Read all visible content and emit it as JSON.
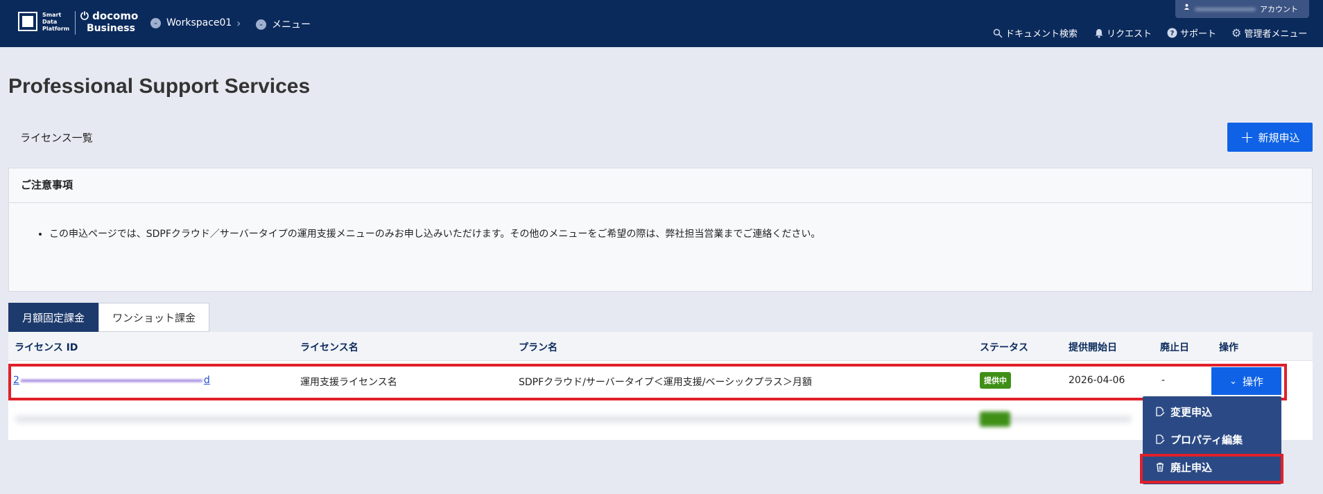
{
  "header": {
    "logo_lines": [
      "Smart",
      "Data",
      "Platform"
    ],
    "brand_top": "docomo",
    "brand_bottom": "Business",
    "breadcrumb": [
      "Workspace01",
      "メニュー"
    ],
    "account_label": "アカウント",
    "utilities": [
      "ドキュメント検索",
      "リクエスト",
      "サポート",
      "管理者メニュー"
    ]
  },
  "page": {
    "title": "Professional Support Services",
    "list_title": "ライセンス一覧",
    "new_button": "新規申込"
  },
  "notice": {
    "heading": "ご注意事項",
    "items": [
      "この申込ページでは、SDPFクラウド／サーバータイプの運用支援メニューのみお申し込みいただけます。その他のメニューをご希望の際は、弊社担当営業までご連絡ください。"
    ]
  },
  "tabs": [
    "月額固定課金",
    "ワンショット課金"
  ],
  "table": {
    "headers": [
      "ライセンス ID",
      "ライセンス名",
      "プラン名",
      "ステータス",
      "提供開始日",
      "廃止日",
      "操作"
    ],
    "rows": [
      {
        "id_start": "2",
        "id_end": "d",
        "license_name": "運用支援ライセンス名",
        "plan_name": "SDPFクラウド/サーバータイプ＜運用支援/ベーシックプラス＞月額",
        "status": "提供中",
        "start_date": "2026-04-06",
        "end_date": "-",
        "action": "操作"
      }
    ]
  },
  "action_menu": [
    "変更申込",
    "プロパティ編集",
    "廃止申込"
  ],
  "colors": {
    "header_bg": "#0b2a5c",
    "primary": "#0f62e6",
    "status_green": "#3f8f17",
    "highlight_red": "#e0202a",
    "menu_bg": "#2b4a85"
  }
}
